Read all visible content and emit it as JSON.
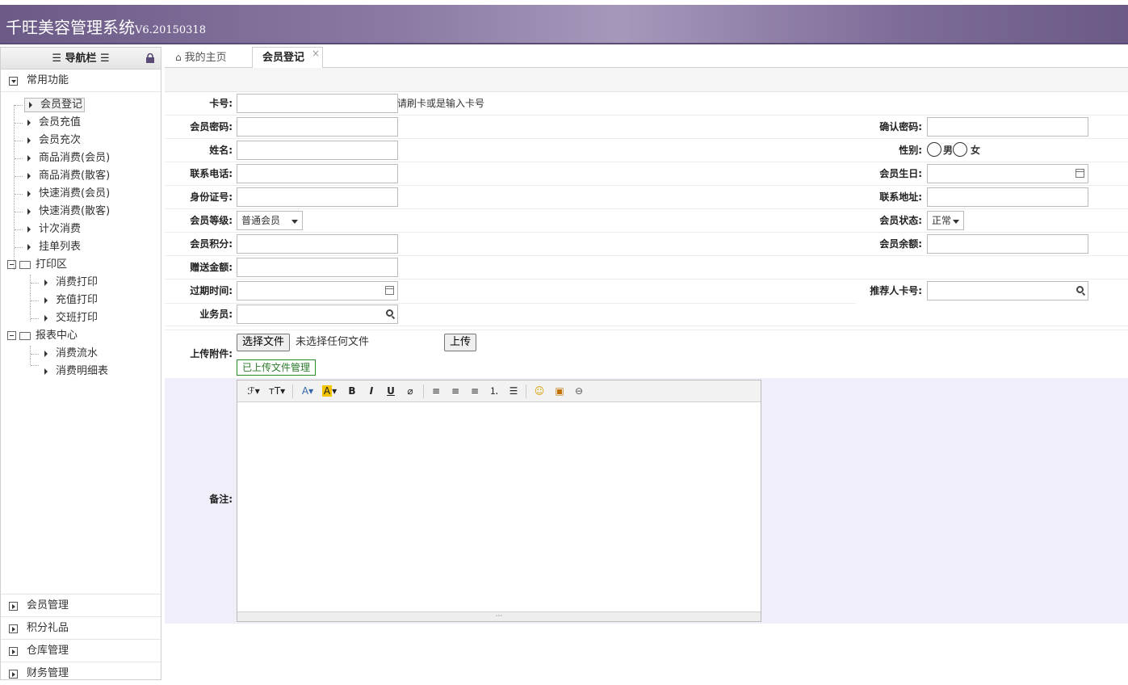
{
  "app": {
    "title": "千旺美容管理系统",
    "version": "V6.20150318"
  },
  "sidebar": {
    "header": "☰ 导航栏 ☰",
    "common_panel": "常用功能",
    "items": [
      "会员登记",
      "会员充值",
      "会员充次",
      "商品消费(会员)",
      "商品消费(散客)",
      "快速消费(会员)",
      "快速消费(散客)",
      "计次消费",
      "挂单列表"
    ],
    "print_folder": "打印区",
    "print_items": [
      "消费打印",
      "充值打印",
      "交班打印"
    ],
    "report_folder": "报表中心",
    "report_items": [
      "消费流水",
      "消费明细表"
    ],
    "bottom_panels": [
      "会员管理",
      "积分礼品",
      "仓库管理",
      "财务管理"
    ]
  },
  "tabs": {
    "home": "我的主页",
    "active": "会员登记",
    "close": "×"
  },
  "form": {
    "card_no": "卡号:",
    "card_hint": "请刷卡或是输入卡号",
    "password": "会员密码:",
    "confirm_password": "确认密码:",
    "name": "姓名:",
    "gender": "性别:",
    "male": "男",
    "female": "女",
    "phone": "联系电话:",
    "birthday": "会员生日:",
    "id_no": "身份证号:",
    "address": "联系地址:",
    "level": "会员等级:",
    "level_value": "普通会员",
    "status": "会员状态:",
    "status_value": "正常",
    "points": "会员积分:",
    "balance": "会员余额:",
    "gift_amount": "赠送金额:",
    "expire": "过期时间:",
    "referrer": "推荐人卡号:",
    "salesman": "业务员:",
    "upload": "上传附件:",
    "choose_file": "选择文件",
    "no_file": "未选择任何文件",
    "upload_btn": "上传",
    "uploaded_mgmt": "已上传文件管理",
    "remark": "备注:"
  },
  "editor": {
    "tools": [
      "ℱ▾",
      "тT▾",
      "A▾",
      "A▾",
      "B",
      "I",
      "U",
      "⌀",
      "≡",
      "≡",
      "≡",
      "⒈",
      "☰",
      "☺",
      "▣",
      "⊖"
    ]
  },
  "colors": {
    "header": "#6b5a86",
    "accent": "#5a4a75",
    "remark_bg": "#f0eef8"
  }
}
